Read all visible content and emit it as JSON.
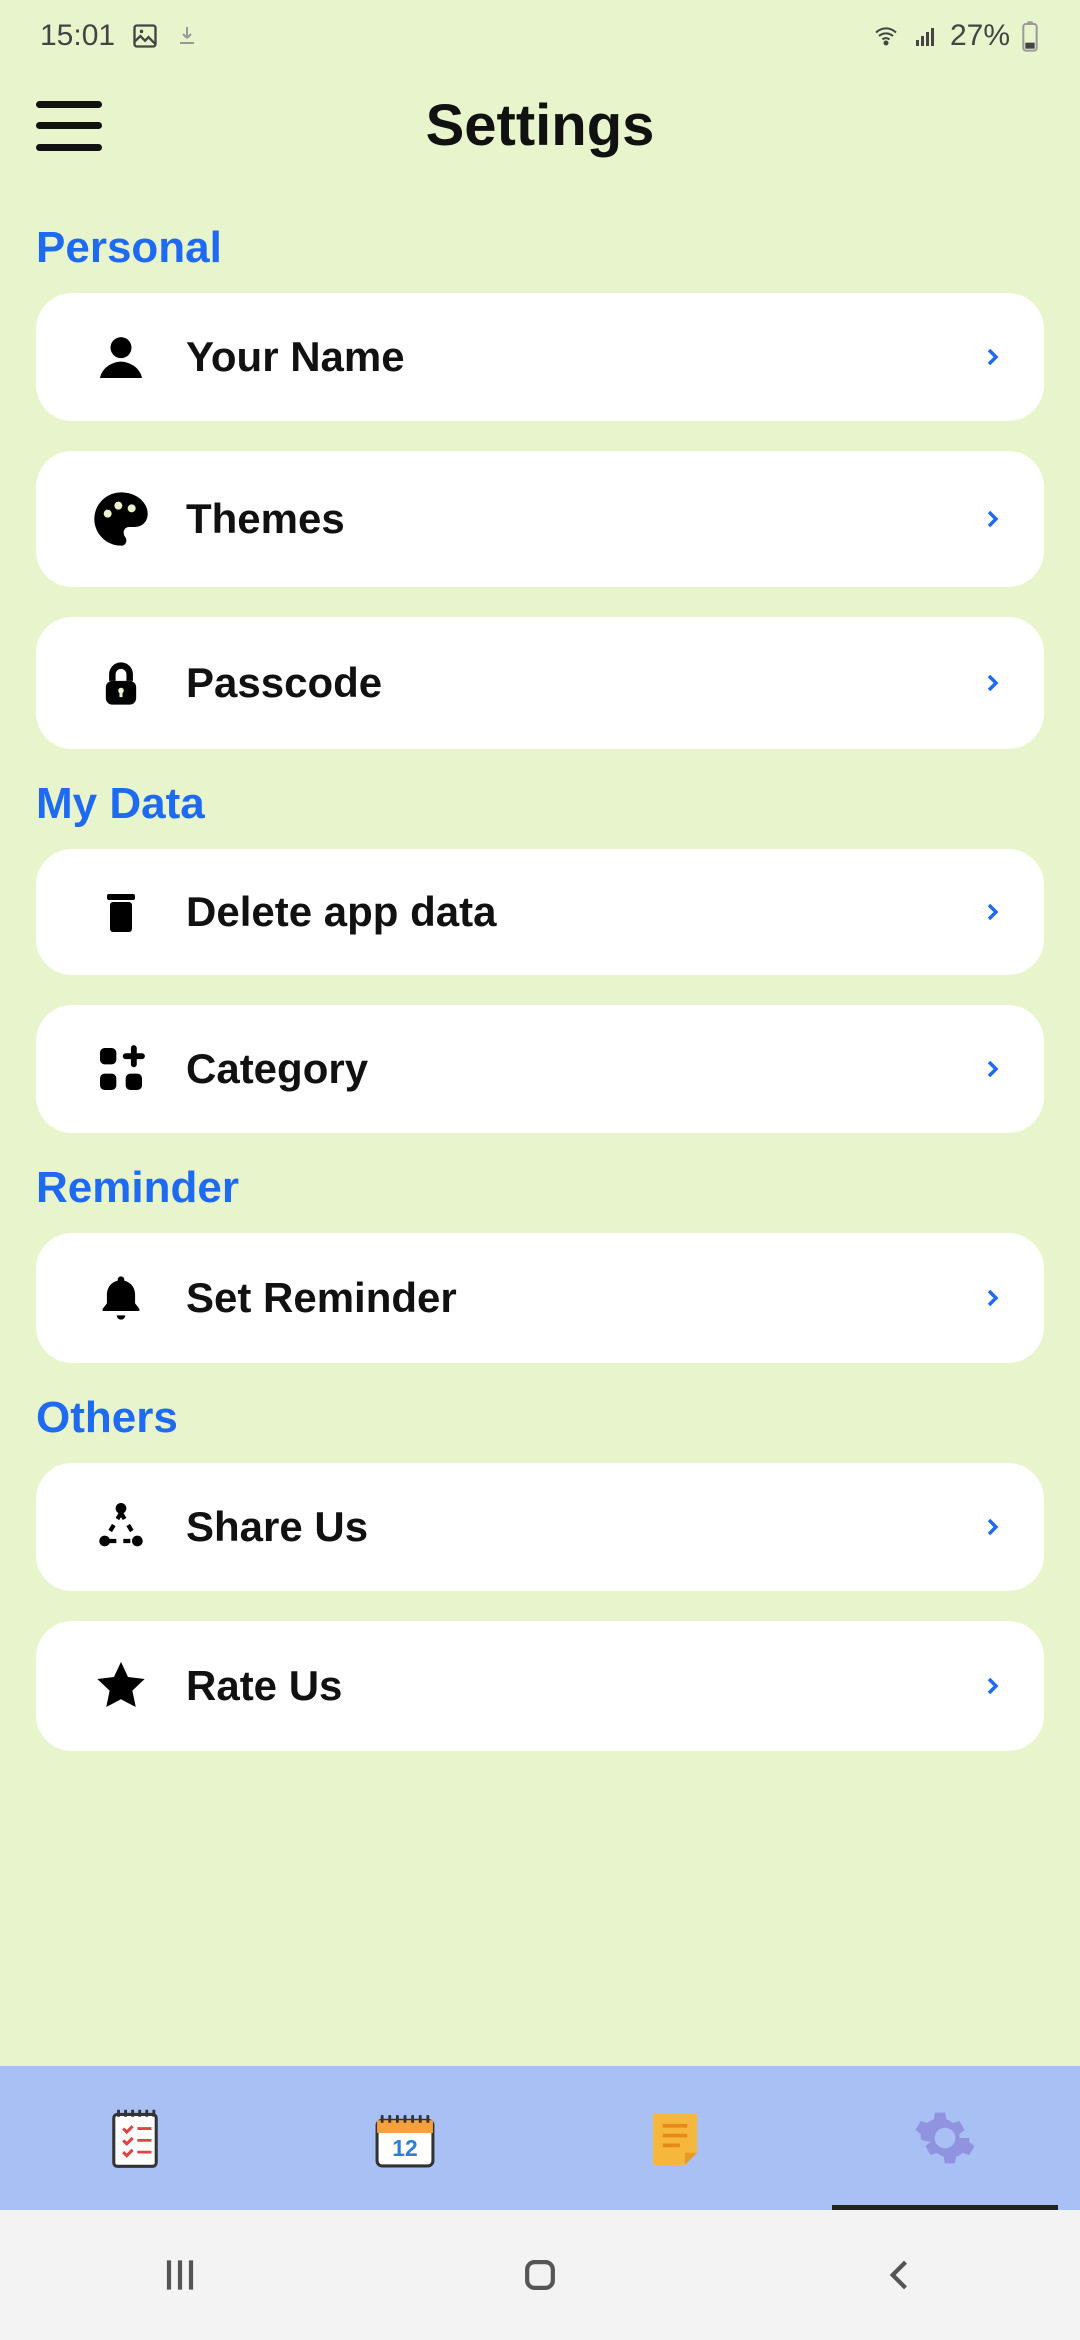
{
  "statusbar": {
    "time": "15:01",
    "battery": "27%"
  },
  "header": {
    "title": "Settings"
  },
  "sections": {
    "personal": {
      "title": "Personal",
      "your_name": "Your Name",
      "themes": "Themes",
      "passcode": "Passcode"
    },
    "my_data": {
      "title": "My Data",
      "delete": "Delete app data",
      "category": "Category"
    },
    "reminder": {
      "title": "Reminder",
      "set_reminder": "Set Reminder"
    },
    "others": {
      "title": "Others",
      "share_us": "Share Us",
      "rate_us": "Rate Us"
    }
  }
}
